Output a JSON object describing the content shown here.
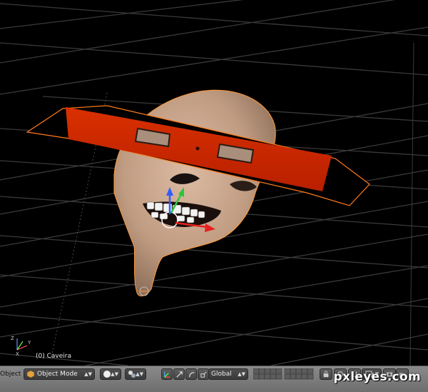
{
  "viewport": {
    "object_label": "(0) Caveira"
  },
  "header": {
    "editor_label": "Object",
    "mode": "Object Mode",
    "orientation": "Global"
  },
  "watermark": "pxleyes.com",
  "colors": {
    "background": "#000000",
    "grid": "#3c3c3c",
    "header": "#7a7a7a",
    "skin": "#c9a58c",
    "mask_red": "#d42500",
    "selection_outline": "#ff8c1a"
  },
  "icons": [
    "object-mode-cube-icon",
    "shading-sphere-icon",
    "pivot-icon",
    "manipulator-icon",
    "layers-grid-icon",
    "render-icon",
    "lock-icon",
    "camera-icon"
  ]
}
